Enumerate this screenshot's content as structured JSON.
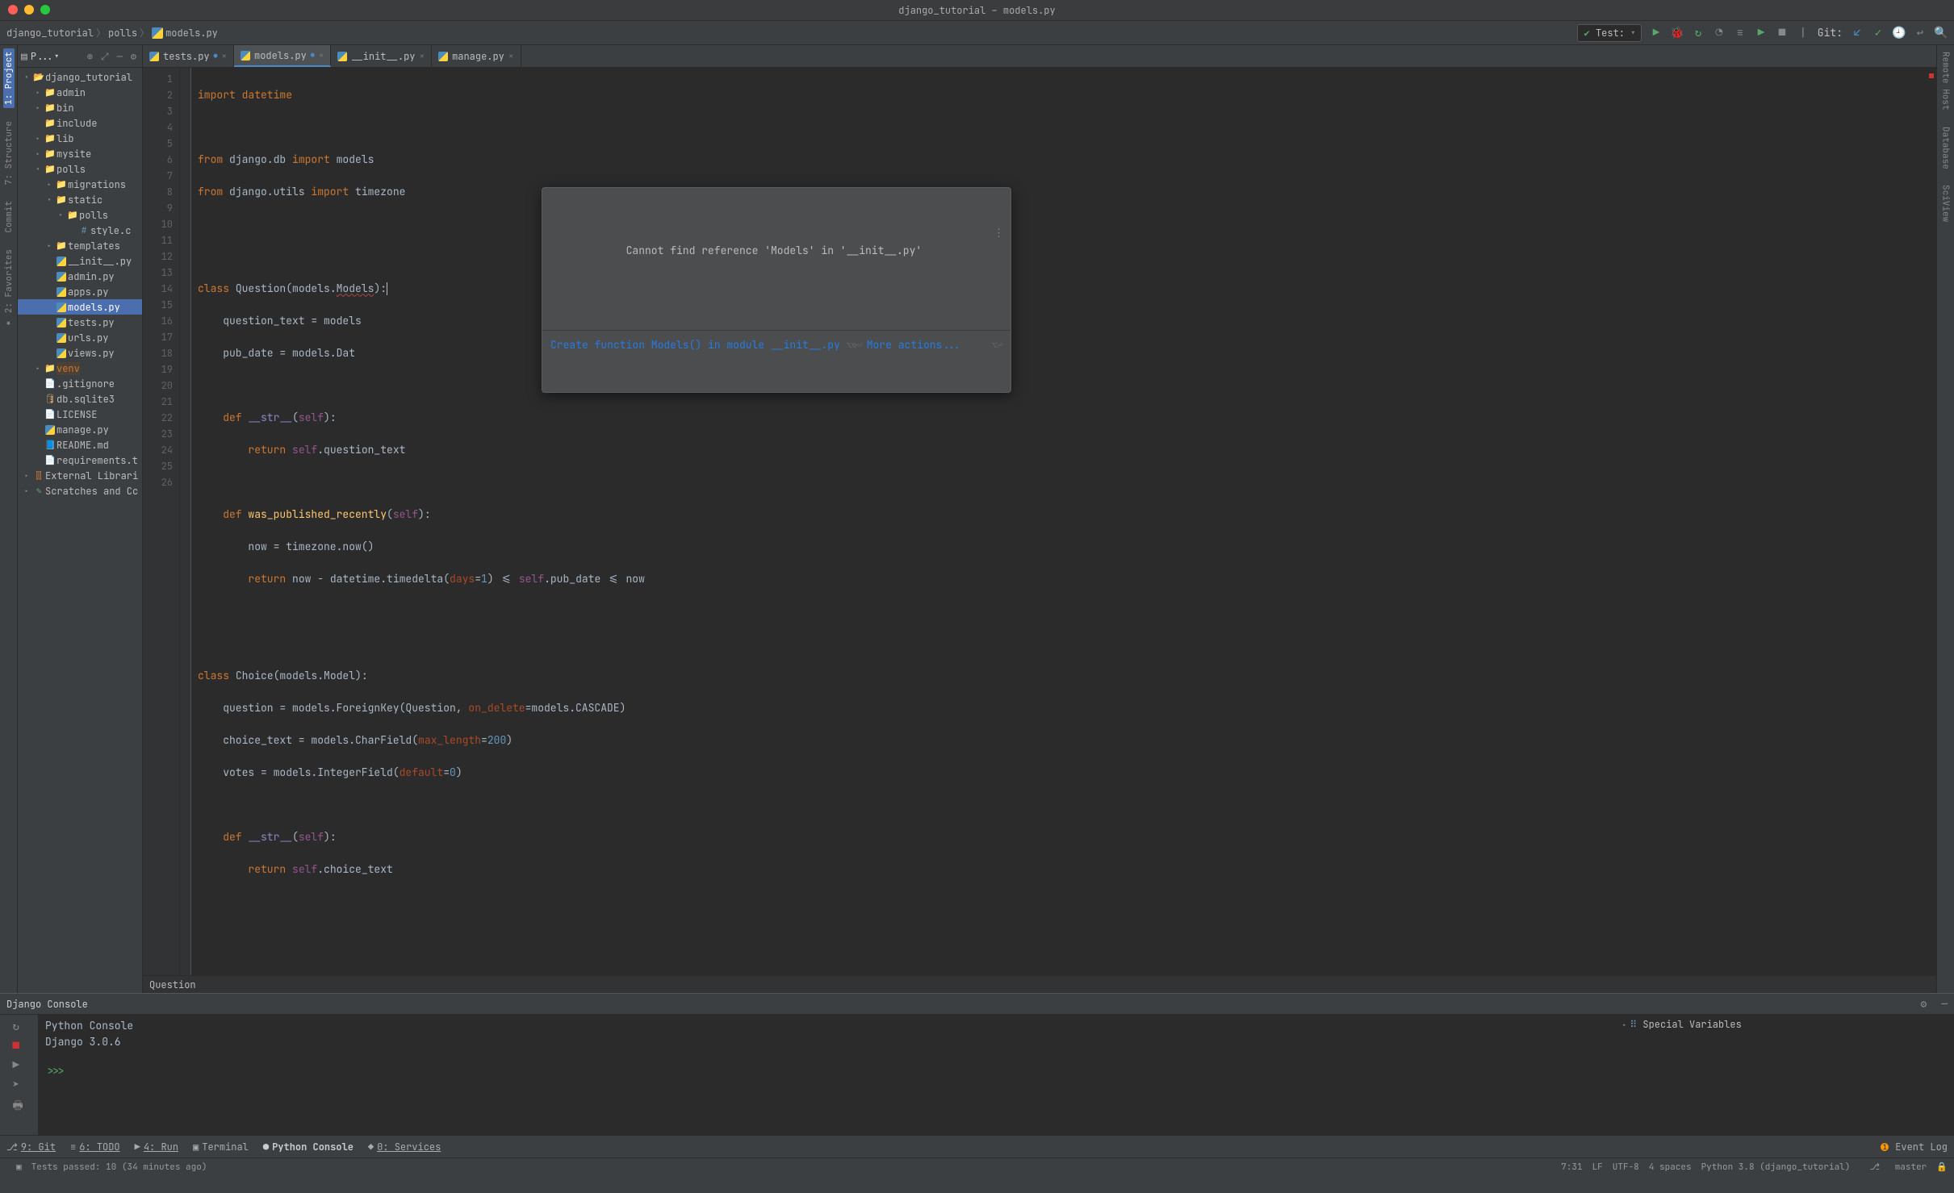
{
  "title": "django_tutorial – models.py",
  "breadcrumbs": [
    "django_tutorial",
    "polls",
    "models.py"
  ],
  "run_config": "Test:",
  "git_label": "Git:",
  "left_strips": [
    {
      "label": "1: Project",
      "active": true
    },
    {
      "label": "7: Structure",
      "active": false
    },
    {
      "label": "Commit",
      "active": false
    },
    {
      "label": "★ 2: Favorites",
      "active": false
    }
  ],
  "right_strips": [
    {
      "label": "Remote Host",
      "active": false
    },
    {
      "label": "Database",
      "active": false
    },
    {
      "label": "SciView",
      "active": false
    }
  ],
  "project_panel_title": "P...▾",
  "tree": [
    {
      "d": 0,
      "ico": "folder-open",
      "txt": "django_tutorial",
      "arrow": "▾"
    },
    {
      "d": 1,
      "ico": "folder",
      "txt": "admin",
      "arrow": "▸"
    },
    {
      "d": 1,
      "ico": "folder",
      "txt": "bin",
      "arrow": "▸"
    },
    {
      "d": 1,
      "ico": "folder",
      "txt": "include",
      "arrow": ""
    },
    {
      "d": 1,
      "ico": "folder-o",
      "txt": "lib",
      "arrow": "▸"
    },
    {
      "d": 1,
      "ico": "folder",
      "txt": "mysite",
      "arrow": "▸"
    },
    {
      "d": 1,
      "ico": "folder",
      "txt": "polls",
      "arrow": "▾"
    },
    {
      "d": 2,
      "ico": "folder",
      "txt": "migrations",
      "arrow": "▸"
    },
    {
      "d": 2,
      "ico": "folder",
      "txt": "static",
      "arrow": "▾"
    },
    {
      "d": 3,
      "ico": "folder",
      "txt": "polls",
      "arrow": "▾"
    },
    {
      "d": 4,
      "ico": "css",
      "txt": "style.c",
      "arrow": ""
    },
    {
      "d": 2,
      "ico": "folder-p",
      "txt": "templates",
      "arrow": "▸"
    },
    {
      "d": 2,
      "ico": "py",
      "txt": "__init__.py",
      "arrow": ""
    },
    {
      "d": 2,
      "ico": "py",
      "txt": "admin.py",
      "arrow": ""
    },
    {
      "d": 2,
      "ico": "py",
      "txt": "apps.py",
      "arrow": ""
    },
    {
      "d": 2,
      "ico": "py",
      "txt": "models.py",
      "arrow": "",
      "sel": true
    },
    {
      "d": 2,
      "ico": "py",
      "txt": "tests.py",
      "arrow": ""
    },
    {
      "d": 2,
      "ico": "py",
      "txt": "urls.py",
      "arrow": ""
    },
    {
      "d": 2,
      "ico": "py",
      "txt": "views.py",
      "arrow": ""
    },
    {
      "d": 1,
      "ico": "folder-o",
      "txt": "venv",
      "arrow": "▸",
      "hl": "venv"
    },
    {
      "d": 1,
      "ico": "txt",
      "txt": ".gitignore",
      "arrow": ""
    },
    {
      "d": 1,
      "ico": "db",
      "txt": "db.sqlite3",
      "arrow": ""
    },
    {
      "d": 1,
      "ico": "txt",
      "txt": "LICENSE",
      "arrow": ""
    },
    {
      "d": 1,
      "ico": "py",
      "txt": "manage.py",
      "arrow": ""
    },
    {
      "d": 1,
      "ico": "md",
      "txt": "README.md",
      "arrow": ""
    },
    {
      "d": 1,
      "ico": "txt",
      "txt": "requirements.t",
      "arrow": ""
    },
    {
      "d": 0,
      "ico": "lib",
      "txt": "External Librari",
      "arrow": "▸"
    },
    {
      "d": 0,
      "ico": "scr",
      "txt": "Scratches and Cc",
      "arrow": "▸"
    }
  ],
  "editor_tabs": [
    {
      "name": "tests.py",
      "active": false,
      "dirty": true
    },
    {
      "name": "models.py",
      "active": true,
      "dirty": true
    },
    {
      "name": "__init__.py",
      "active": false,
      "dirty": false
    },
    {
      "name": "manage.py",
      "active": false,
      "dirty": false
    }
  ],
  "line_count": 26,
  "code": {
    "l1": "import datetime",
    "l3a": "from",
    "l3b": " django.db ",
    "l3c": "import",
    "l3d": " models",
    "l4a": "from",
    "l4b": " django.utils ",
    "l4c": "import",
    "l4d": " timezone",
    "l7a": "class ",
    "l7b": "Question",
    "l7c": "(models.",
    "l7err": "Models",
    "l7d": "):",
    "l8a": "    question_text = models",
    "l8b": "",
    "l9a": "    pub_date = models.Dat",
    "l9b": "",
    "l11a": "    def ",
    "l11b": "__str__",
    "l11c": "(",
    "l11d": "self",
    "l11e": "):",
    "l12a": "        return ",
    "l12b": "self",
    "l12c": ".question_text",
    "l14a": "    def ",
    "l14b": "was_published_recently",
    "l14c": "(",
    "l14d": "self",
    "l14e": "):",
    "l15a": "        now = timezone.now()",
    "l16a": "        return ",
    "l16b": "now - datetime.timedelta(",
    "l16c": "days",
    "l16d": "=",
    "l16e": "1",
    "l16f": ") <= ",
    "l16g": "self",
    "l16h": ".pub_date <= now",
    "l19a": "class ",
    "l19b": "Choice",
    "l19c": "(models.Model):",
    "l20a": "    question = models.ForeignKey(Question, ",
    "l20b": "on_delete",
    "l20c": "=models.CASCADE)",
    "l21a": "    choice_text = models.CharField(",
    "l21b": "max_length",
    "l21c": "=",
    "l21d": "200",
    "l21e": ")",
    "l22a": "    votes = models.IntegerField(",
    "l22b": "default",
    "l22c": "=",
    "l22d": "0",
    "l22e": ")",
    "l24a": "    def ",
    "l24b": "__str__",
    "l24c": "(",
    "l24d": "self",
    "l24e": "):",
    "l25a": "        return ",
    "l25b": "self",
    "l25c": ".choice_text"
  },
  "popup": {
    "message": "Cannot find reference 'Models' in '__init__.py'",
    "action1": "Create function Models() in module __init__.py",
    "hint1": "⌥⇧⏎",
    "action2": "More actions...",
    "hint2": "⌥⏎"
  },
  "breadcrumb_scope": "Question",
  "console": {
    "title": "Django Console",
    "line1": "Python Console",
    "line2": "Django 3.0.6",
    "prompt": ">>>",
    "special_vars": "Special Variables"
  },
  "bottom_tools": {
    "git": "9: Git",
    "todo": "6: TODO",
    "run": "4: Run",
    "terminal": "Terminal",
    "pyconsole": "Python Console",
    "services": "0: Services",
    "event_log": "Event Log"
  },
  "status": {
    "tests": "Tests passed: 10 (34 minutes ago)",
    "pos": "7:31",
    "lf": "LF",
    "enc": "UTF-8",
    "indent": "4 spaces",
    "interp": "Python 3.8 (django_tutorial)",
    "branch": "master",
    "branch_icon": "⎇"
  }
}
